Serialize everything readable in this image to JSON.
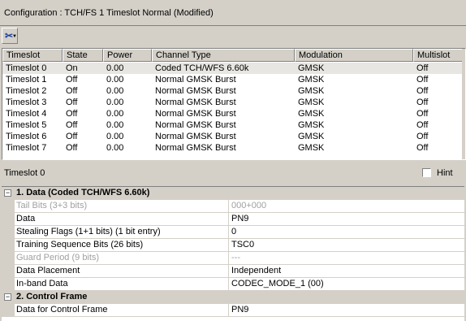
{
  "window": {
    "title": "Configuration :  TCH/FS 1 Timeslot Normal (Modified)"
  },
  "toolbar": {
    "tool_icon": "tools-icon"
  },
  "grid": {
    "columns": [
      "Timeslot",
      "State",
      "Power",
      "Channel Type",
      "Modulation",
      "Multislot"
    ],
    "rows": [
      [
        "Timeslot 0",
        "On",
        "0.00",
        "Coded TCH/WFS 6.60k",
        "GMSK",
        "Off"
      ],
      [
        "Timeslot 1",
        "Off",
        "0.00",
        "Normal GMSK Burst",
        "GMSK",
        "Off"
      ],
      [
        "Timeslot 2",
        "Off",
        "0.00",
        "Normal GMSK Burst",
        "GMSK",
        "Off"
      ],
      [
        "Timeslot 3",
        "Off",
        "0.00",
        "Normal GMSK Burst",
        "GMSK",
        "Off"
      ],
      [
        "Timeslot 4",
        "Off",
        "0.00",
        "Normal GMSK Burst",
        "GMSK",
        "Off"
      ],
      [
        "Timeslot 5",
        "Off",
        "0.00",
        "Normal GMSK Burst",
        "GMSK",
        "Off"
      ],
      [
        "Timeslot 6",
        "Off",
        "0.00",
        "Normal GMSK Burst",
        "GMSK",
        "Off"
      ],
      [
        "Timeslot 7",
        "Off",
        "0.00",
        "Normal GMSK Burst",
        "GMSK",
        "Off"
      ]
    ]
  },
  "selected_timeslot": "Timeslot 0",
  "hint": {
    "label": "Hint",
    "checked": false
  },
  "properties": {
    "categories": [
      {
        "title": "1. Data (Coded TCH/WFS 6.60k)",
        "toggle": "⊟",
        "items": [
          {
            "name": "Tail Bits (3+3 bits)",
            "value": "000+000",
            "disabled": true
          },
          {
            "name": "Data",
            "value": "PN9",
            "disabled": false
          },
          {
            "name": "Stealing Flags (1+1 bits) (1 bit entry)",
            "value": "0",
            "disabled": false
          },
          {
            "name": "Training Sequence Bits (26 bits)",
            "value": "TSC0",
            "disabled": false
          },
          {
            "name": "Guard Period (9 bits)",
            "value": "---",
            "disabled": true
          },
          {
            "name": "Data Placement",
            "value": "Independent",
            "disabled": false
          },
          {
            "name": "In-band Data",
            "value": "CODEC_MODE_1 (00)",
            "disabled": false
          }
        ]
      },
      {
        "title": "2. Control Frame",
        "toggle": "⊟",
        "items": [
          {
            "name": "Data for Control Frame",
            "value": "PN9",
            "disabled": false
          }
        ]
      }
    ]
  }
}
